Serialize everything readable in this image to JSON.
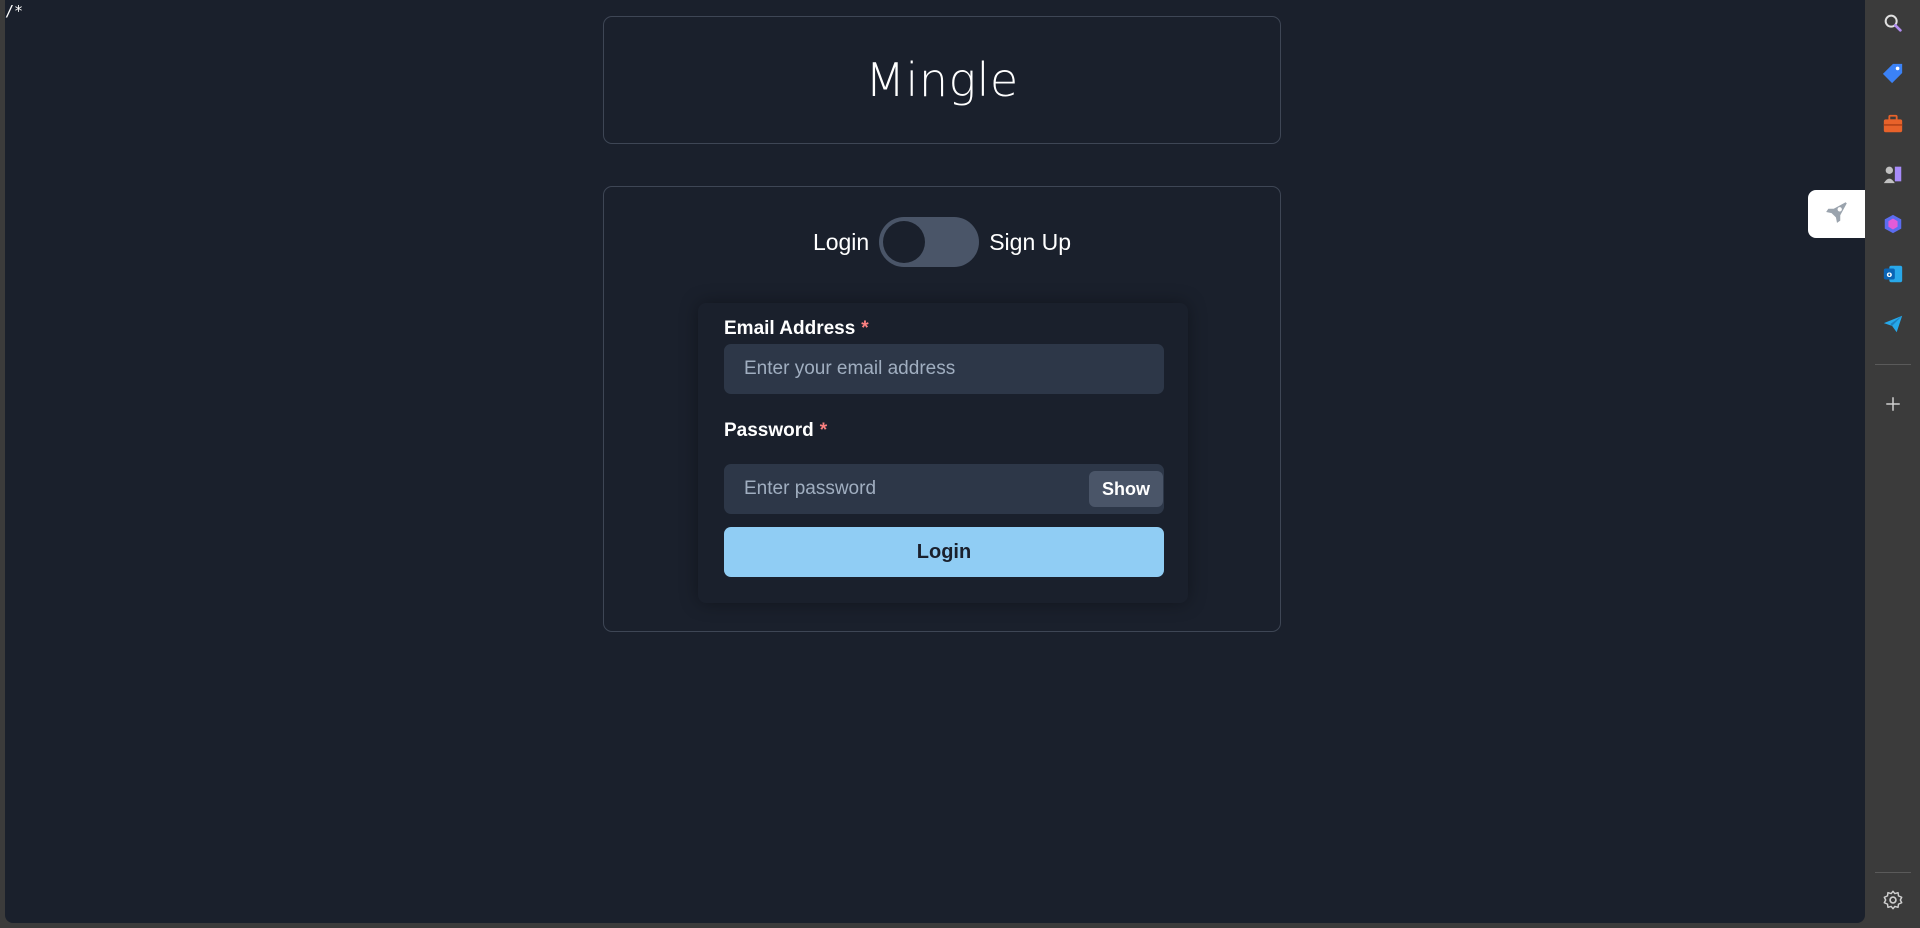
{
  "stray_text": "/*",
  "app": {
    "title": "Mingle"
  },
  "auth_mode": {
    "left_label": "Login",
    "right_label": "Sign Up",
    "selected": "Login"
  },
  "form": {
    "email": {
      "label": "Email Address",
      "required_mark": "*",
      "placeholder": "Enter your email address",
      "value": ""
    },
    "password": {
      "label": "Password",
      "required_mark": "*",
      "placeholder": "Enter password",
      "value": "",
      "toggle_label": "Show"
    },
    "submit_label": "Login"
  },
  "sidebar": {
    "icons": [
      "search-icon",
      "tag-icon",
      "briefcase-icon",
      "games-icon",
      "copilot-icon",
      "outlook-icon",
      "send-icon",
      "add-icon",
      "settings-icon"
    ]
  },
  "colors": {
    "background": "#1a202c",
    "input_background": "#2d3748",
    "primary_button": "#90cdf4",
    "required": "#fc8181"
  }
}
